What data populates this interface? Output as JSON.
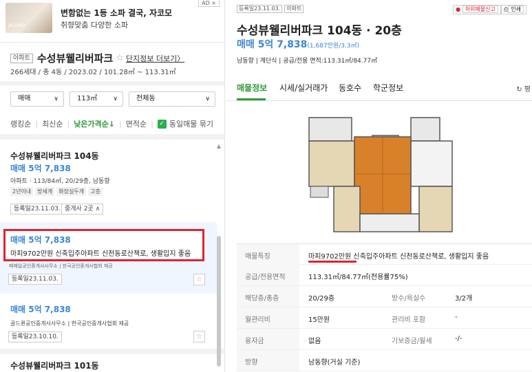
{
  "ad": {
    "title": "변함없는 1등 소파 결국, 자코모",
    "subtitle": "취향맞춤 다양한 소파",
    "tag": "AD ×",
    "logo": "JACOMO"
  },
  "complex": {
    "badge": "아파트",
    "name": "수성뷰웰리버파크",
    "detail_link": "단지정보 더보기",
    "info": "266세대 / 총 4동 / 2023.02 / 101.28㎡ ~ 113.31㎡"
  },
  "filters": {
    "trade": "매매",
    "area": "113㎡",
    "dong": "전체동"
  },
  "sorts": {
    "ranking": "랭킹순",
    "latest": "최신순",
    "low_price": "낮은가격순↓",
    "area": "면적순",
    "same_listing": "동일매물 묶기"
  },
  "listings": [
    {
      "title": "수성뷰웰리버파크 104동",
      "price": "매매 5억 7,838",
      "desc": "아파트 · 113/84㎡, 20/29층, 남동향",
      "tags": [
        "2년이내",
        "방세개",
        "화장실두개",
        "고층"
      ],
      "registered": "등록일23.11.03.",
      "agents": "중개사 2곳"
    },
    {
      "price": "매매 5억 7,838",
      "feature": "마피9702만원 신축입주아파트 신천동로산책로, 생활입지 좋음",
      "hidden_agent": "매매일공인중개사사무소 | 한국공인중개사협회 제공",
      "registered": "등록일23.11.03."
    },
    {
      "price": "매매 5억 7,838",
      "agent": "골드퀸공인중개사사무소 | 한국공인중개사협회 제공",
      "registered": "등록일23.10.10."
    },
    {
      "title": "수성뷰웰리버파크 101동"
    }
  ],
  "detail": {
    "registered_badge": "등록일23.11.03.",
    "type_badge": "아파트",
    "report": "허위매물신고",
    "print": "인쇄",
    "title": "수성뷰웰리버파크 104동 · 20층",
    "price": "매매 5억 7,838",
    "price_unit": "(1,687만원/3.3㎡)",
    "sub": "남동향 | 계단식 | 공급/전용 면적:113.31㎡/84.77㎡",
    "tabs": [
      "매물정보",
      "시세/실거래가",
      "동호수",
      "학군정보"
    ],
    "refresh": "평",
    "rows": [
      {
        "k": "매물특징",
        "v": "마피9702만원 신축입주아파트 신천동로산책로, 생활입지 좋음"
      },
      {
        "k": "공급/전용면적",
        "v": "113.31㎡/84.77㎡(전용률75%)"
      },
      {
        "k": "해당층/총층",
        "v": "20/29층",
        "k2": "방수/욕실수",
        "v2": "3/2개"
      },
      {
        "k": "월관리비",
        "v": "15만원",
        "k2": "관리비 포함",
        "v2": "-"
      },
      {
        "k": "융자금",
        "v": "없음",
        "k2": "기보증금/월세",
        "v2": "-/-"
      },
      {
        "k": "방향",
        "v": "남동향(거실 기준)"
      }
    ]
  },
  "colors": {
    "accent": "#2f9a39",
    "price": "#3a86d8",
    "highlight": "#e0232e"
  }
}
